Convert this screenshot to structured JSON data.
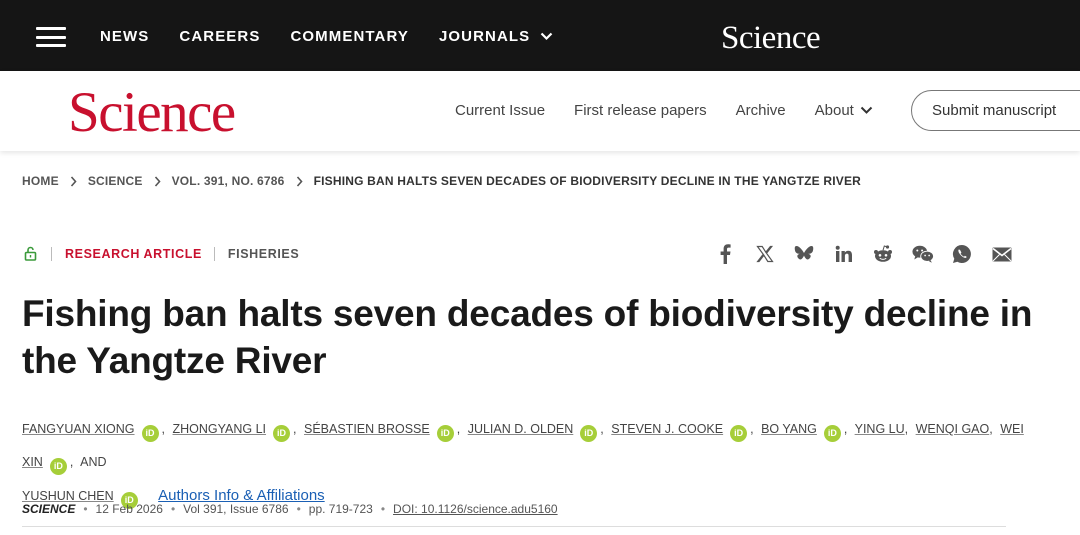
{
  "topbar": {
    "nav": [
      "NEWS",
      "CAREERS",
      "COMMENTARY",
      "JOURNALS"
    ],
    "logo": "Science"
  },
  "header": {
    "logo": "Science",
    "nav": [
      "Current Issue",
      "First release papers",
      "Archive",
      "About"
    ],
    "submit_label": "Submit manuscript"
  },
  "breadcrumb": [
    "HOME",
    "SCIENCE",
    "VOL. 391, NO. 6786",
    "FISHING BAN HALTS SEVEN DECADES OF BIODIVERSITY DECLINE IN THE YANGTZE RIVER"
  ],
  "article": {
    "type": "RESEARCH ARTICLE",
    "subject": "FISHERIES",
    "title": "Fishing ban halts seven decades of biodiversity decline in the Yangtze River",
    "authors": [
      "FANGYUAN XIONG",
      "ZHONGYANG LI",
      "SÉBASTIEN BROSSE",
      "JULIAN D. OLDEN",
      "STEVEN J. COOKE",
      "BO YANG",
      "YING LU",
      "WENQI GAO",
      "WEI XIN",
      "YUSHUN CHEN"
    ],
    "and_text": "AND",
    "orcid_label": "iD",
    "affiliations_link": "Authors Info & Affiliations",
    "journal": "SCIENCE",
    "date": "12 Feb 2026",
    "volume": "Vol 391, Issue 6786",
    "pages": "pp. 719-723",
    "doi": "DOI: 10.1126/science.adu5160"
  },
  "share_icons": [
    "facebook-icon",
    "x-icon",
    "bluesky-icon",
    "linkedin-icon",
    "reddit-icon",
    "wechat-icon",
    "whatsapp-icon",
    "email-icon"
  ],
  "colors": {
    "topbar": "#151515",
    "brand_red": "#c8102e",
    "orcid_green": "#a6ce39",
    "link_blue": "#1a5fb4",
    "lock_green": "#3a9a3a"
  }
}
